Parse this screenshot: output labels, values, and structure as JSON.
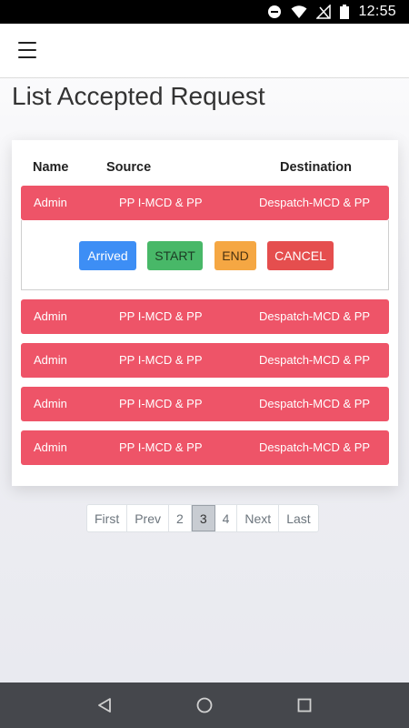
{
  "status_bar": {
    "time": "12:55",
    "icons": [
      "do-not-disturb-icon",
      "wifi-icon",
      "signal-off-icon",
      "battery-icon"
    ]
  },
  "app_bar": {
    "menu_icon": "hamburger-menu-icon"
  },
  "page": {
    "title": "List Accepted Request"
  },
  "table": {
    "headers": {
      "name": "Name",
      "source": "Source",
      "destination": "Destination"
    },
    "rows": [
      {
        "name": "Admin",
        "source": "PP I-MCD & PP",
        "destination": "Despatch-MCD & PP"
      },
      {
        "name": "Admin",
        "source": "PP I-MCD & PP",
        "destination": "Despatch-MCD & PP"
      },
      {
        "name": "Admin",
        "source": "PP I-MCD & PP",
        "destination": "Despatch-MCD & PP"
      },
      {
        "name": "Admin",
        "source": "PP I-MCD & PP",
        "destination": "Despatch-MCD & PP"
      },
      {
        "name": "Admin",
        "source": "PP I-MCD & PP",
        "destination": "Despatch-MCD & PP"
      }
    ],
    "actions": {
      "arrived": "Arrived",
      "start": "START",
      "end": "END",
      "cancel": "CANCEL"
    }
  },
  "pagination": {
    "first": "First",
    "prev": "Prev",
    "pages": [
      "2",
      "3",
      "4"
    ],
    "active_page": "3",
    "next": "Next",
    "last": "Last"
  },
  "nav_bar": {
    "icons": [
      "back-icon",
      "home-icon",
      "recents-icon"
    ]
  },
  "colors": {
    "row": "#ee5468",
    "arrived": "#3d8ef5",
    "start": "#48b868",
    "end": "#f5a743",
    "cancel": "#e54e4e"
  }
}
